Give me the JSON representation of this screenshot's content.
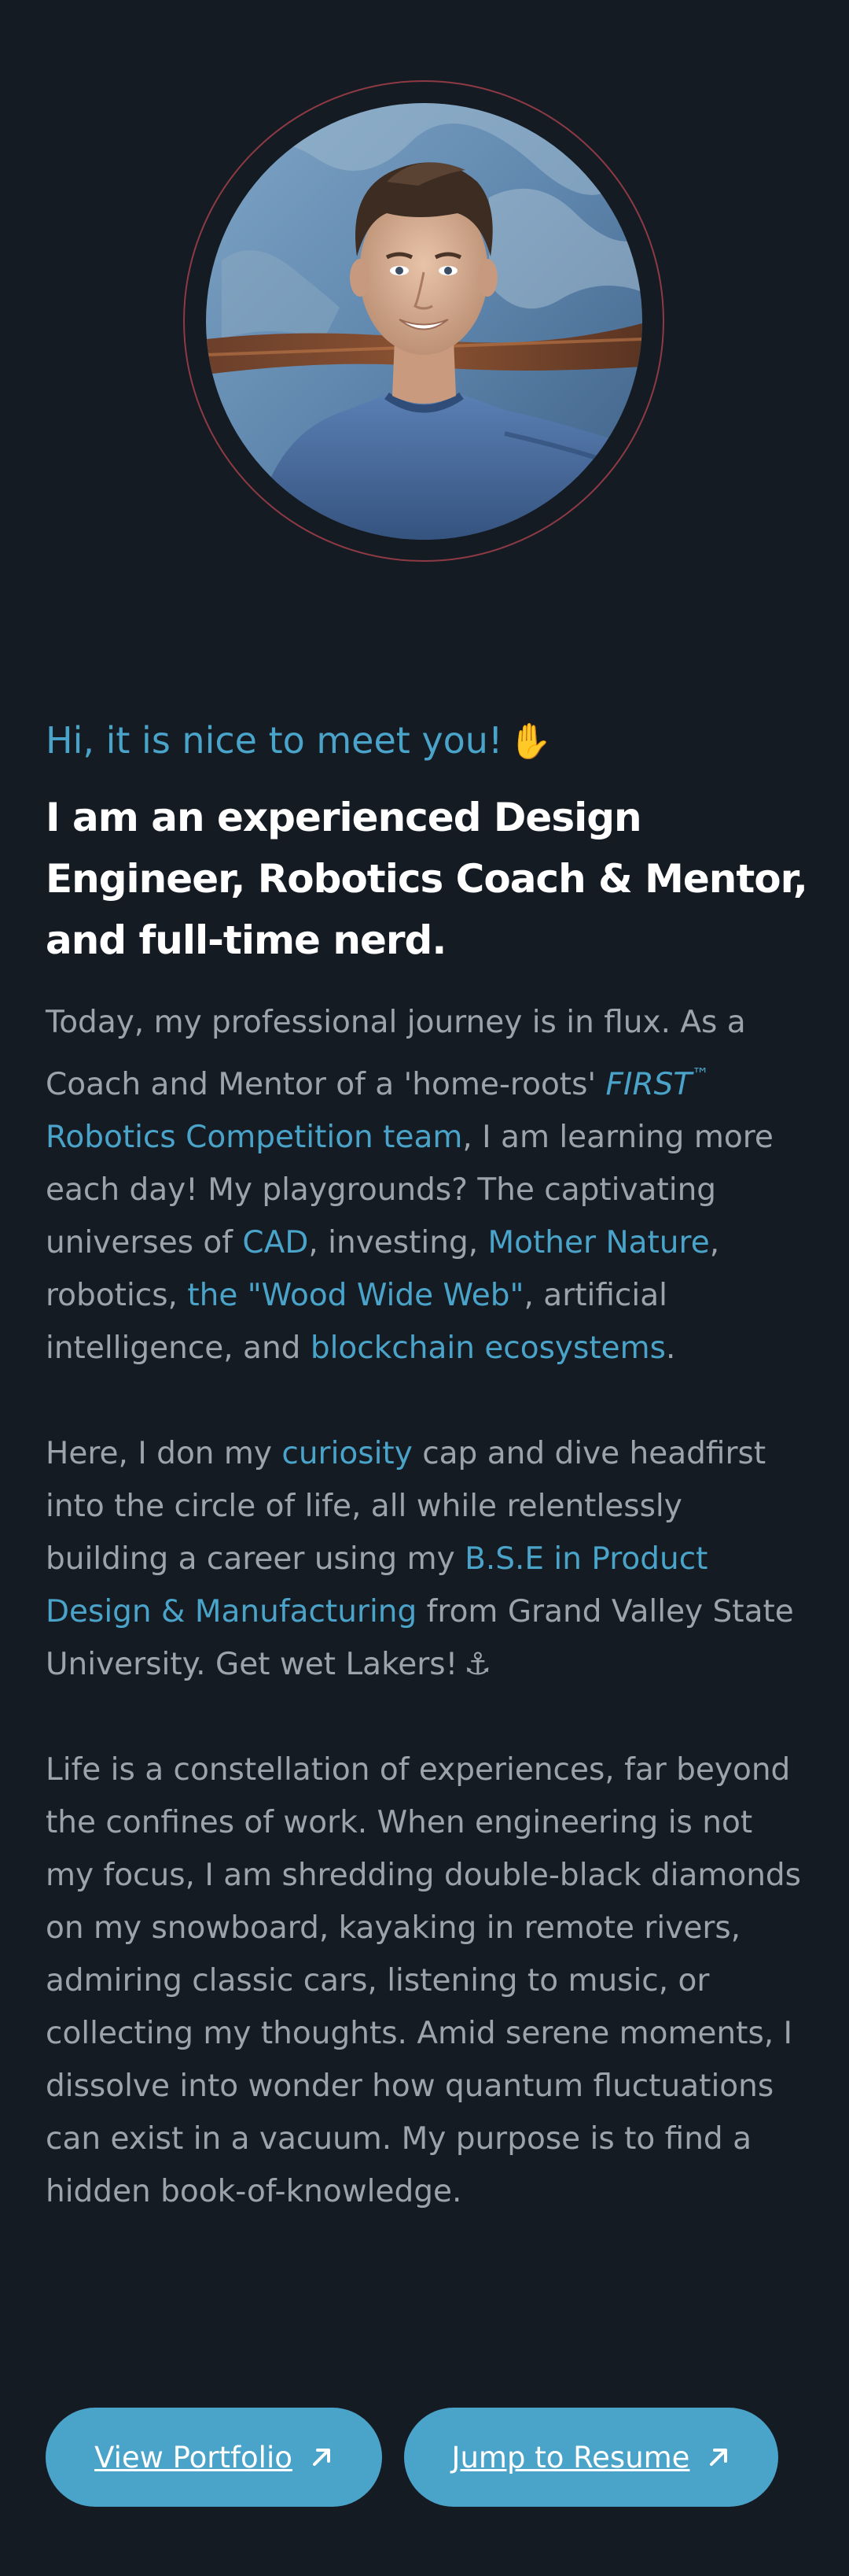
{
  "profile": {
    "avatar_alt": "portrait photo",
    "ring_color": "#8e3a45"
  },
  "intro": {
    "greeting": "Hi, it is nice to meet you!",
    "greeting_icon": "waving-hand-icon",
    "headline": "I am an experienced Design Engineer, Robotics Coach & Mentor, and full-time nerd."
  },
  "paragraph1": {
    "t1": "Today, my professional journey is in flux. As a Coach and Mentor of a 'home-roots' ",
    "first": "FIRST",
    "tm": "™",
    "link_robotics": "Robotics Competition team",
    "t2": ", I am learning more each day! My playgrounds? The captivating universes of ",
    "link_cad": "CAD",
    "t3": ", investing, ",
    "link_nature": "Mother Nature",
    "t4": ", robotics, ",
    "link_wood": "the \"Wood Wide Web\"",
    "t5": ", artificial intelligence, and ",
    "link_blockchain": "blockchain ecosystems",
    "t6": "."
  },
  "paragraph2": {
    "t1": "Here, I don my ",
    "link_curiosity": "curiosity",
    "t2": " cap and dive headfirst into the circle of life, all while relentlessly building a career using my ",
    "link_degree": "B.S.E in Product Design & Manufacturing",
    "t3": " from Grand Valley State University. Get wet Lakers!",
    "anchor": "⚓"
  },
  "paragraph3": {
    "text": "Life is a constellation of experiences, far beyond the confines of work. When engineering is not my focus, I am shredding double-black diamonds on my snowboard, kayaking in remote rivers, admiring classic cars, listening to music, or collecting my thoughts. Amid serene moments, I dissolve into wonder how quantum fluctuations can exist in a vacuum. My purpose is to find a hidden book-of-knowledge."
  },
  "buttons": {
    "portfolio": "View Portfolio",
    "resume": "Jump to Resume",
    "icon": "arrow-up-right-icon"
  },
  "colors": {
    "background": "#151b23",
    "accent": "#4aa3c9",
    "body_text": "#9ca3ab",
    "heading": "#ffffff"
  }
}
